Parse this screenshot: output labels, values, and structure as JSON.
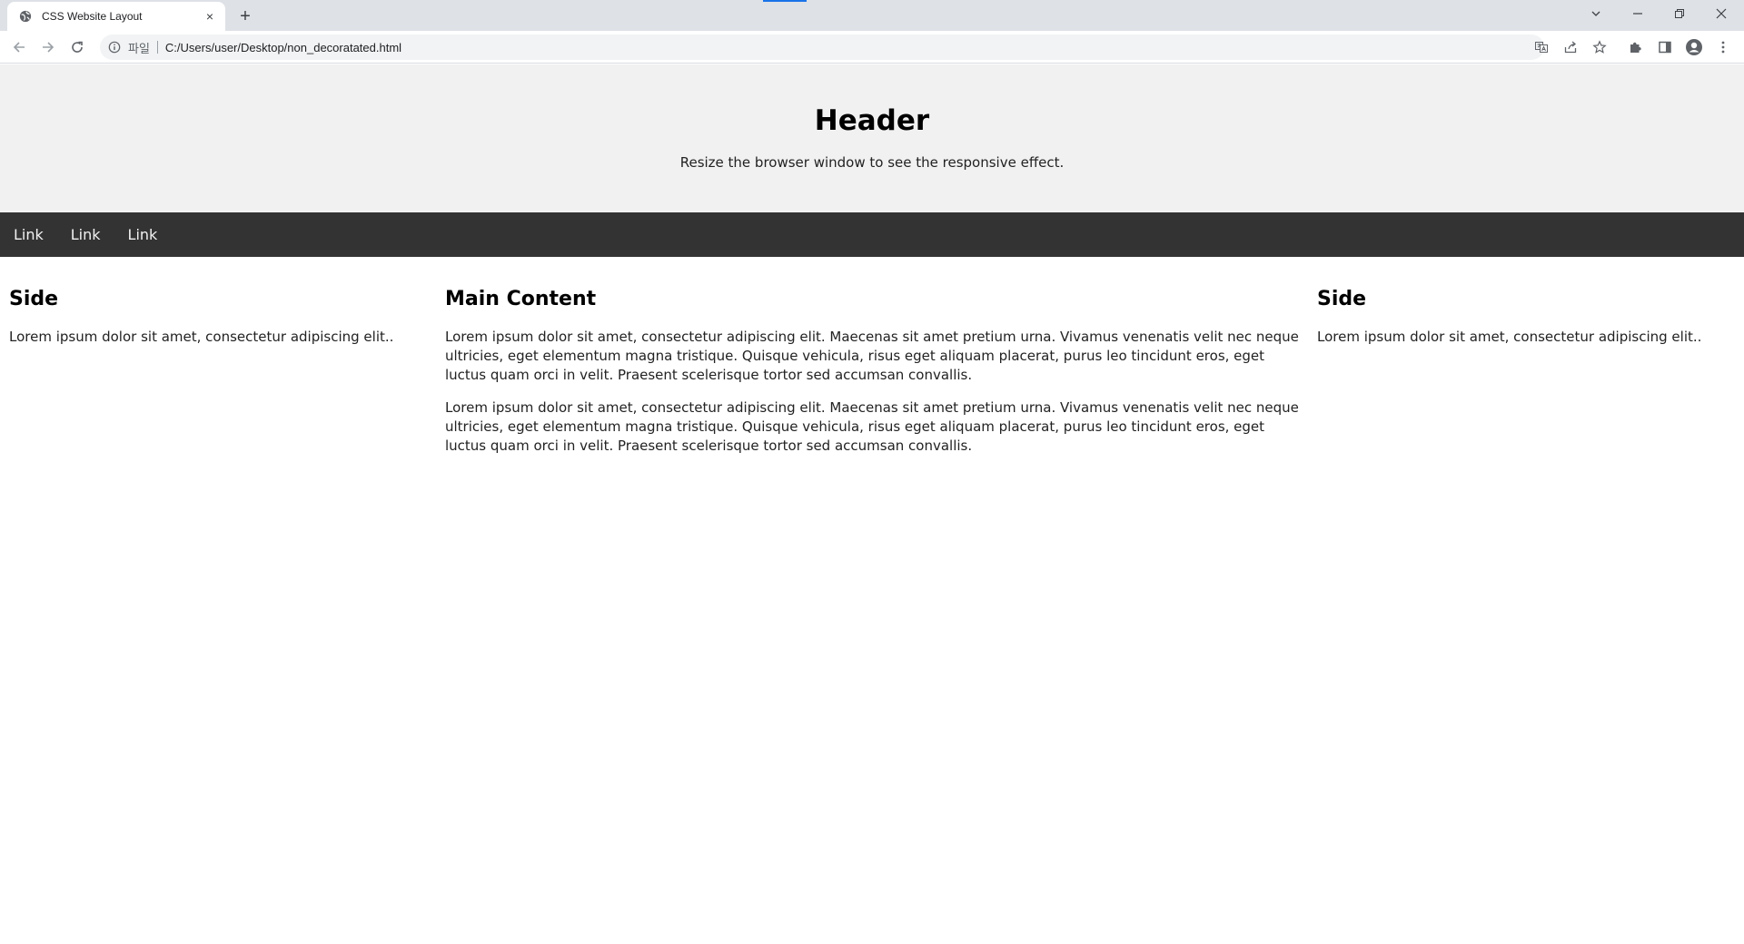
{
  "browser": {
    "tab_title": "CSS Website Layout",
    "new_tab_label": "+",
    "close_tab_label": "×",
    "omnibox": {
      "scheme_label": "파일",
      "url": "C:/Users/user/Desktop/non_decoratated.html"
    },
    "icons": {
      "favicon": "globe-icon",
      "back": "arrow-left-icon",
      "forward": "arrow-right-icon",
      "reload": "reload-icon",
      "info": "info-icon",
      "translate": "translate-icon",
      "share": "share-icon",
      "bookmark": "star-icon",
      "extensions": "puzzle-icon",
      "side_panel": "side-panel-icon",
      "profile": "avatar-icon",
      "menu": "kebab-menu-icon",
      "tab_search": "chevron-down-icon",
      "minimize": "minimize-icon",
      "restore": "restore-icon",
      "close": "close-icon"
    },
    "accent_color": "#1a73e8"
  },
  "page": {
    "header": {
      "title": "Header",
      "subtitle": "Resize the browser window to see the responsive effect."
    },
    "nav": {
      "links": [
        "Link",
        "Link",
        "Link"
      ],
      "background": "#333333"
    },
    "left_side": {
      "title": "Side",
      "text": "Lorem ipsum dolor sit amet, consectetur adipiscing elit.."
    },
    "main": {
      "title": "Main Content",
      "paragraphs": [
        "Lorem ipsum dolor sit amet, consectetur adipiscing elit. Maecenas sit amet pretium urna. Vivamus venenatis velit nec neque ultricies, eget elementum magna tristique. Quisque vehicula, risus eget aliquam placerat, purus leo tincidunt eros, eget luctus quam orci in velit. Praesent scelerisque tortor sed accumsan convallis.",
        "Lorem ipsum dolor sit amet, consectetur adipiscing elit. Maecenas sit amet pretium urna. Vivamus venenatis velit nec neque ultricies, eget elementum magna tristique. Quisque vehicula, risus eget aliquam placerat, purus leo tincidunt eros, eget luctus quam orci in velit. Praesent scelerisque tortor sed accumsan convallis."
      ]
    },
    "right_side": {
      "title": "Side",
      "text": "Lorem ipsum dolor sit amet, consectetur adipiscing elit.."
    }
  }
}
